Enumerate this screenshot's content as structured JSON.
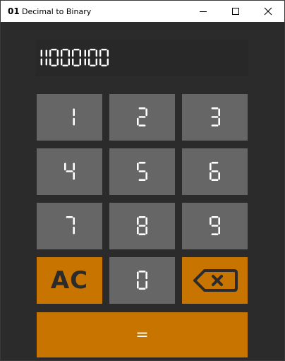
{
  "window": {
    "icon_text": "01",
    "title": "Decimal to Binary"
  },
  "display": {
    "value": "11000100"
  },
  "keypad": {
    "digits": [
      "1",
      "2",
      "3",
      "4",
      "5",
      "6",
      "7",
      "8",
      "9",
      "0"
    ],
    "clear_label": "AC",
    "equals_label": "="
  },
  "colors": {
    "background": "#2b2b2b",
    "key": "#666666",
    "accent": "#c87400",
    "digit": "#ffffff"
  },
  "icons": {
    "backspace": "backspace-icon",
    "minimize": "minimize-icon",
    "maximize": "maximize-icon",
    "close": "close-icon"
  }
}
